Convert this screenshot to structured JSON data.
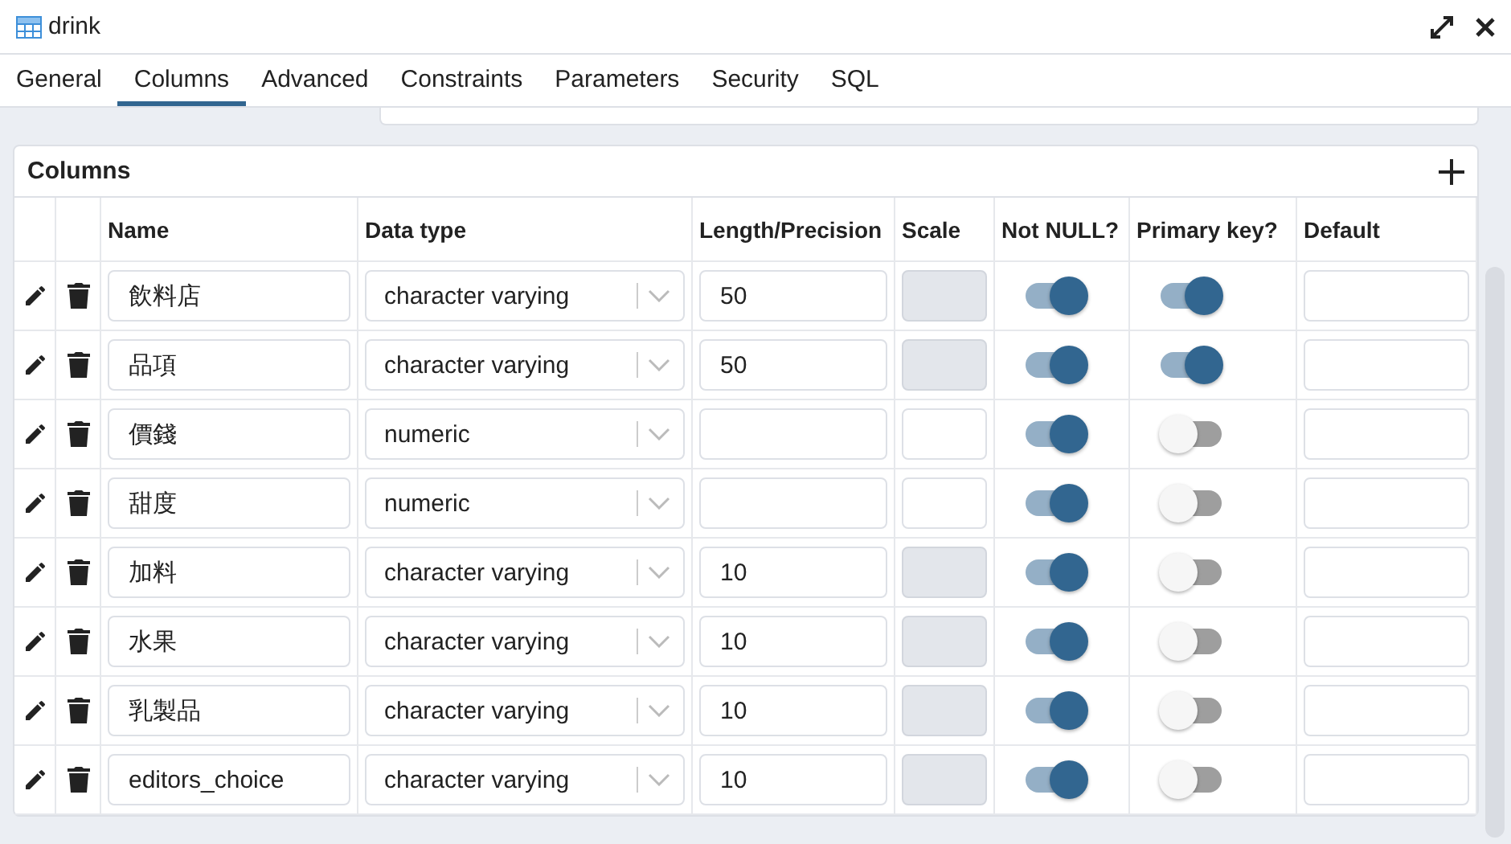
{
  "window": {
    "title": "drink"
  },
  "tabs": [
    {
      "label": "General",
      "selected": false
    },
    {
      "label": "Columns",
      "selected": true
    },
    {
      "label": "Advanced",
      "selected": false
    },
    {
      "label": "Constraints",
      "selected": false
    },
    {
      "label": "Parameters",
      "selected": false
    },
    {
      "label": "Security",
      "selected": false
    },
    {
      "label": "SQL",
      "selected": false
    }
  ],
  "panel": {
    "title": "Columns"
  },
  "table": {
    "columns": [
      "Name",
      "Data type",
      "Length/Precision",
      "Scale",
      "Not NULL?",
      "Primary key?",
      "Default"
    ],
    "rows": [
      {
        "name": "飲料店",
        "data_type": "character varying",
        "length": "50",
        "scale_disabled": true,
        "not_null": true,
        "primary_key": true
      },
      {
        "name": "品項",
        "data_type": "character varying",
        "length": "50",
        "scale_disabled": true,
        "not_null": true,
        "primary_key": true
      },
      {
        "name": "價錢",
        "data_type": "numeric",
        "length": "",
        "scale_disabled": false,
        "not_null": true,
        "primary_key": false
      },
      {
        "name": "甜度",
        "data_type": "numeric",
        "length": "",
        "scale_disabled": false,
        "not_null": true,
        "primary_key": false
      },
      {
        "name": "加料",
        "data_type": "character varying",
        "length": "10",
        "scale_disabled": true,
        "not_null": true,
        "primary_key": false
      },
      {
        "name": "水果",
        "data_type": "character varying",
        "length": "10",
        "scale_disabled": true,
        "not_null": true,
        "primary_key": false
      },
      {
        "name": "乳製品",
        "data_type": "character varying",
        "length": "10",
        "scale_disabled": true,
        "not_null": true,
        "primary_key": false
      },
      {
        "name": "editors_choice",
        "data_type": "character varying",
        "length": "10",
        "scale_disabled": true,
        "not_null": true,
        "primary_key": false
      }
    ]
  }
}
